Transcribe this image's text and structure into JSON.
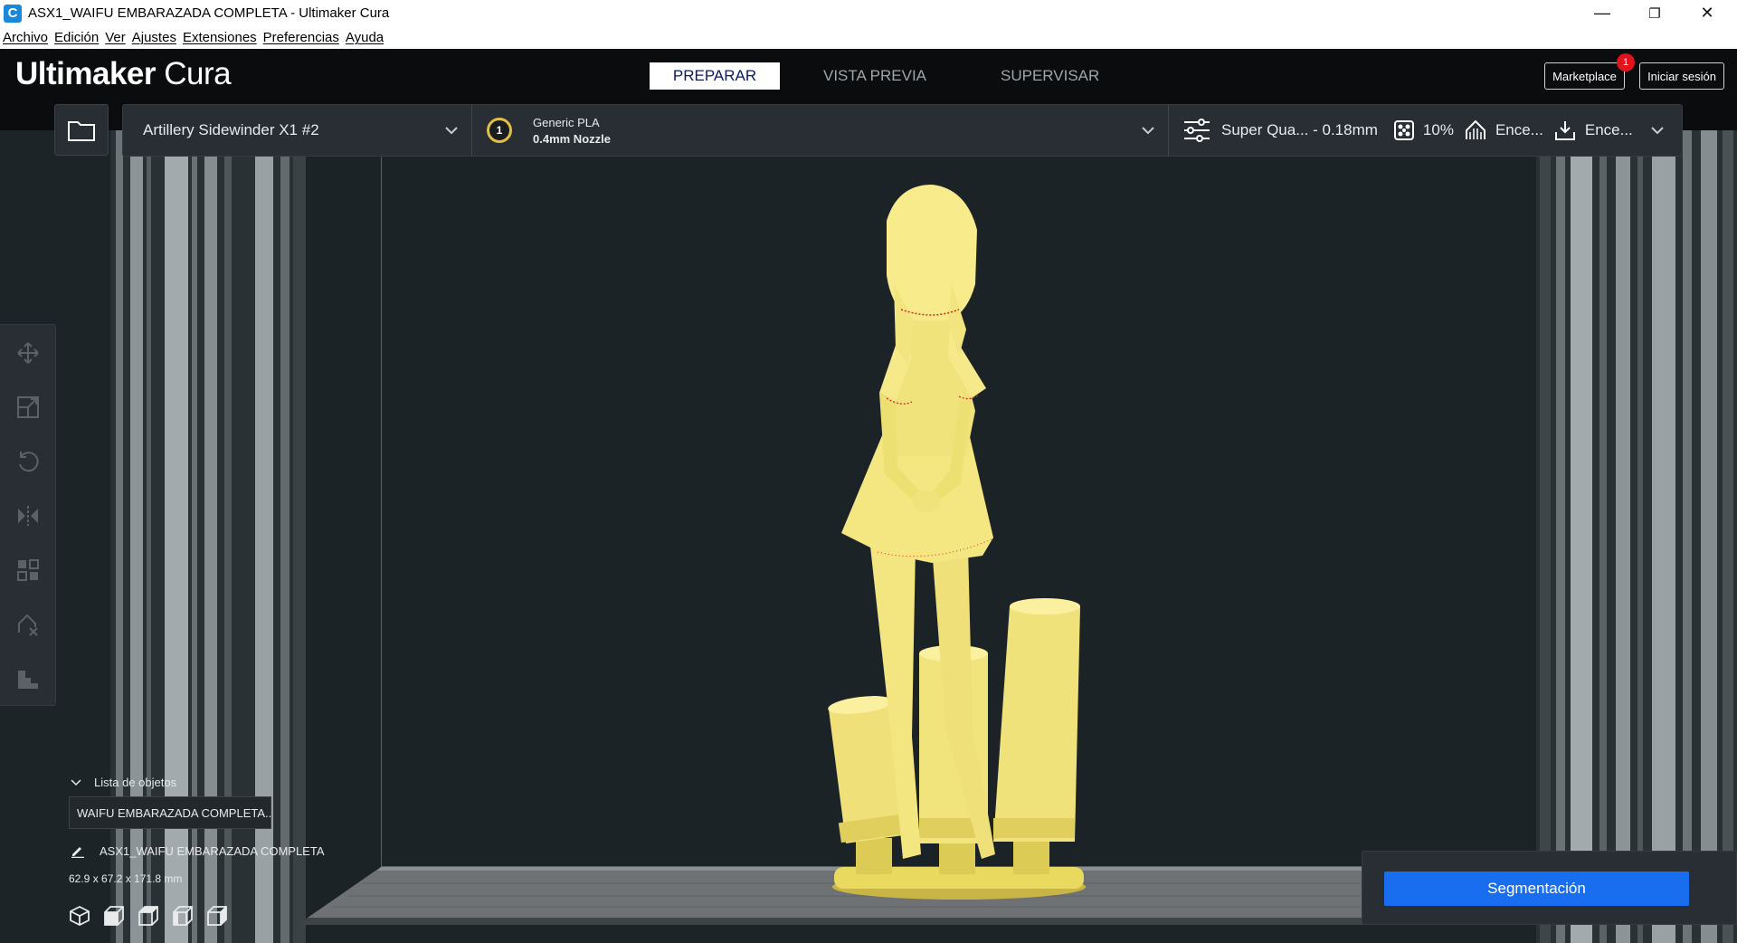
{
  "window": {
    "title": "ASX1_WAIFU EMBARAZADA COMPLETA - Ultimaker Cura",
    "app_icon_letter": "C",
    "minimize": "—",
    "maximize": "❐",
    "close": "✕"
  },
  "menu": [
    {
      "label": "Archivo"
    },
    {
      "label": "Edición"
    },
    {
      "label": "Ver"
    },
    {
      "label": "Ajustes"
    },
    {
      "label": "Extensiones"
    },
    {
      "label": "Preferencias"
    },
    {
      "label": "Ayuda"
    }
  ],
  "header": {
    "logo_bold": "Ultimaker",
    "logo_light": " Cura",
    "tabs": [
      {
        "label": "PREPARAR",
        "active": true
      },
      {
        "label": "VISTA PREVIA",
        "active": false
      },
      {
        "label": "SUPERVISAR",
        "active": false
      }
    ],
    "marketplace_label": "Marketplace",
    "marketplace_badge": "1",
    "signin_label": "Iniciar sesión"
  },
  "toolbar": {
    "printer": "Artillery Sidewinder X1 #2",
    "extruder_number": "1",
    "material": "Generic PLA",
    "nozzle": "0.4mm Nozzle",
    "profile": "Super Qua... - 0.18mm",
    "infill": "10%",
    "support": "Ence...",
    "adhesion": "Ence..."
  },
  "tools": [
    {
      "icon": "move-icon"
    },
    {
      "icon": "scale-icon"
    },
    {
      "icon": "rotate-icon"
    },
    {
      "icon": "mirror-icon"
    },
    {
      "icon": "per-model-settings-icon"
    },
    {
      "icon": "support-blocker-icon"
    },
    {
      "icon": "lay-flat-icon"
    }
  ],
  "object_list": {
    "header": "Lista de objetos",
    "entry": "WAIFU EMBARAZADA COMPLETA...",
    "object_name": "ASX1_WAIFU EMBARAZADA COMPLETA",
    "dimensions": "62.9 x 67.2 x 171.8 mm"
  },
  "slice": {
    "button_label": "Segmentación"
  },
  "colors": {
    "model_yellow": "#f5e77a",
    "accent_blue": "#196ef0",
    "header_bg": "#0a0c0d",
    "panel_bg": "#282e33",
    "badge_red": "#e1141c"
  }
}
